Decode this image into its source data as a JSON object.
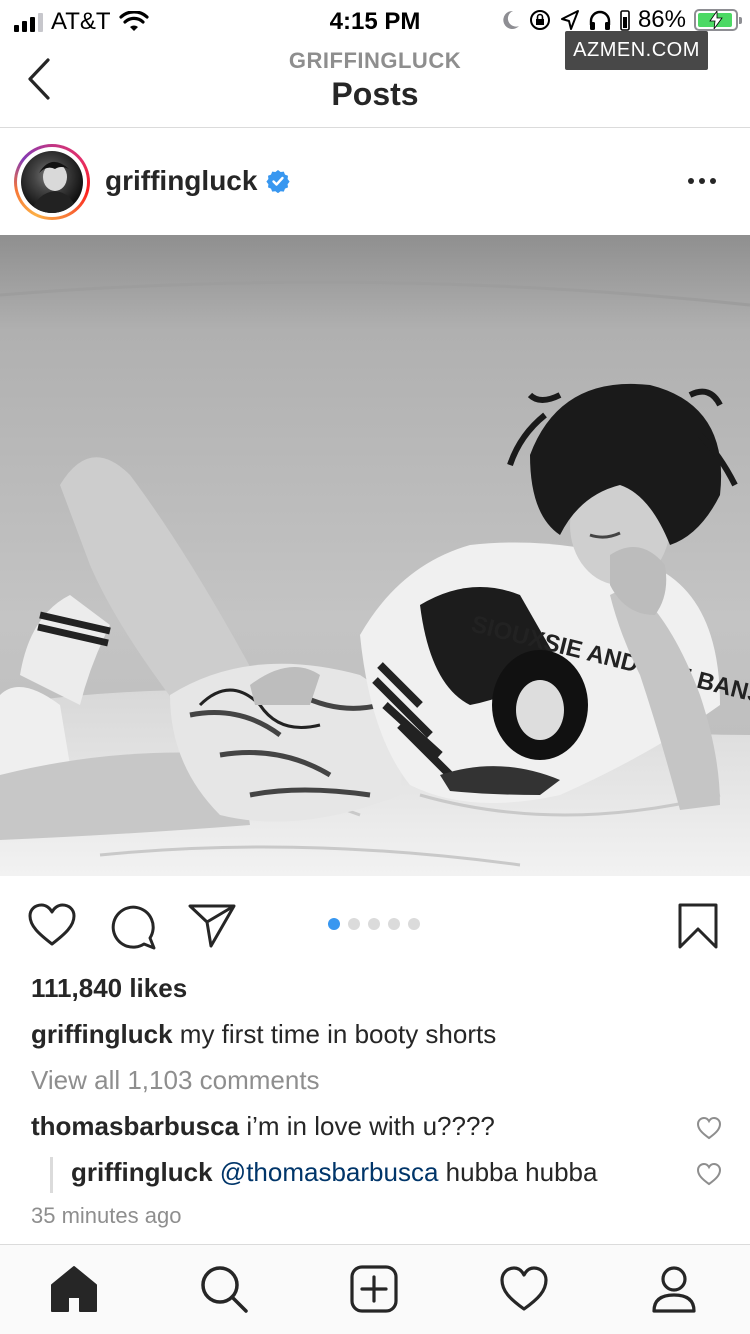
{
  "status_bar": {
    "carrier": "AT&T",
    "time": "4:15 PM",
    "battery_percent": "86%",
    "signal_bars": 3,
    "icons": [
      "wifi-icon",
      "moon-icon",
      "rotation-lock-icon",
      "location-icon",
      "headphones-icon",
      "battery-charging-icon"
    ]
  },
  "watermark": "AZMEN.COM",
  "nav": {
    "subtitle": "GRIFFINGLUCK",
    "title": "Posts",
    "back_icon": "chevron-left-icon"
  },
  "post": {
    "username": "griffingluck",
    "verified": true,
    "more_icon": "more-options-icon",
    "carousel": {
      "total": 5,
      "active_index": 0
    },
    "likes": "111,840 likes",
    "caption": {
      "username": "griffingluck",
      "text": "my first time in booty shorts"
    },
    "view_all_comments": "View all 1,103 comments",
    "comments": [
      {
        "username": "thomasbarbusca",
        "text": "i’m in love with u????"
      }
    ],
    "reply": {
      "username": "griffingluck",
      "mention": "@thomasbarbusca",
      "text": "hubba hubba"
    },
    "timestamp": "35 minutes ago"
  },
  "actions": [
    "heart-icon",
    "comment-icon",
    "share-icon",
    "bookmark-icon"
  ],
  "tabbar": [
    "home-icon",
    "search-icon",
    "new-post-icon",
    "activity-heart-icon",
    "profile-icon"
  ],
  "colors": {
    "accent_blue": "#3897f0",
    "mention_blue": "#003569",
    "text": "#262626",
    "muted": "#8e8e8e",
    "divider": "#dbdbdb"
  }
}
